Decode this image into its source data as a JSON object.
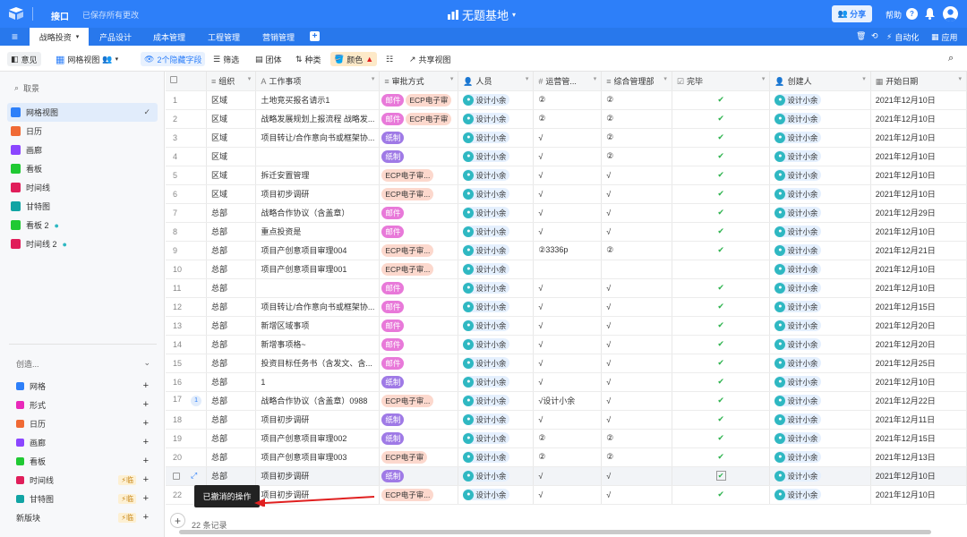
{
  "app": {
    "base_name": "接口",
    "saved_status": "已保存所有更改",
    "title": "无题基地",
    "share": "分享",
    "help": "帮助"
  },
  "tabs": [
    "战略投资",
    "产品设计",
    "成本管理",
    "工程管理",
    "营销管理"
  ],
  "tabbar_right": {
    "automation": "自动化",
    "apps": "应用"
  },
  "toolbar": {
    "views_label": "意见",
    "view_name": "网格视图",
    "hidden_fields": "2个隐藏字段",
    "filter": "筛选",
    "group": "团体",
    "sort": "种类",
    "color": "颜色",
    "share_view": "共享视图"
  },
  "sidebar": {
    "search": "取景",
    "views": [
      {
        "label": "网格视图",
        "icon": "grid-icon",
        "color": "#2d7ff9"
      },
      {
        "label": "日历",
        "icon": "calendar-icon",
        "color": "#f06a35"
      },
      {
        "label": "画廊",
        "icon": "gallery-icon",
        "color": "#8b46ff"
      },
      {
        "label": "看板",
        "icon": "kanban-icon",
        "color": "#20c933"
      },
      {
        "label": "时间线",
        "icon": "timeline-icon",
        "color": "#e01e5a"
      },
      {
        "label": "甘特图",
        "icon": "gantt-icon",
        "color": "#11a4a4"
      },
      {
        "label": "看板 2",
        "icon": "kanban-icon",
        "color": "#20c933"
      },
      {
        "label": "时间线 2",
        "icon": "timeline-icon",
        "color": "#e01e5a"
      }
    ],
    "create": "创造...",
    "create_items": [
      {
        "label": "网格",
        "color": "#2d7ff9",
        "badge": ""
      },
      {
        "label": "形式",
        "color": "#e929ba",
        "badge": ""
      },
      {
        "label": "日历",
        "color": "#f06a35",
        "badge": ""
      },
      {
        "label": "画廊",
        "color": "#8b46ff",
        "badge": ""
      },
      {
        "label": "看板",
        "color": "#20c933",
        "badge": ""
      },
      {
        "label": "时间线",
        "color": "#e01e5a",
        "badge": "临"
      },
      {
        "label": "甘特图",
        "color": "#11a4a4",
        "badge": "临"
      },
      {
        "label": "新版块",
        "color": "",
        "badge": "临"
      }
    ]
  },
  "grid": {
    "columns": [
      "组织",
      "工作事项",
      "审批方式",
      "人员",
      "运营管...",
      "综合管理部",
      "完毕",
      "创建人",
      "开始日期"
    ],
    "rows": [
      {
        "n": "1",
        "org": "区域",
        "item": "土地竞买报名请示1",
        "approval": [
          "邮件",
          "ECP电子审"
        ],
        "person": "设计小余",
        "ops": "②",
        "mgmt": "②",
        "done": true,
        "creator": "设计小余",
        "date": "2021年12月10日"
      },
      {
        "n": "2",
        "org": "区域",
        "item": "战略发展规划上报流程 战略发...",
        "approval": [
          "邮件",
          "ECP电子审"
        ],
        "person": "设计小余",
        "ops": "②",
        "mgmt": "②",
        "done": true,
        "creator": "设计小余",
        "date": "2021年12月10日"
      },
      {
        "n": "3",
        "org": "区域",
        "item": "项目转让/合作意向书或框架协...",
        "approval": [
          "纸制"
        ],
        "person": "设计小余",
        "ops": "√",
        "mgmt": "②",
        "done": true,
        "creator": "设计小余",
        "date": "2021年12月10日"
      },
      {
        "n": "4",
        "org": "区域",
        "item": "",
        "approval": [
          "纸制"
        ],
        "person": "设计小余",
        "ops": "√",
        "mgmt": "②",
        "done": true,
        "creator": "设计小余",
        "date": "2021年12月10日"
      },
      {
        "n": "5",
        "org": "区域",
        "item": "拆迁安置管理",
        "approval": [
          "ECP电子审..."
        ],
        "person": "设计小余",
        "ops": "√",
        "mgmt": "√",
        "done": true,
        "creator": "设计小余",
        "date": "2021年12月10日"
      },
      {
        "n": "6",
        "org": "区域",
        "item": "项目初步调研",
        "approval": [
          "ECP电子审..."
        ],
        "person": "设计小余",
        "ops": "√",
        "mgmt": "√",
        "done": true,
        "creator": "设计小余",
        "date": "2021年12月10日"
      },
      {
        "n": "7",
        "org": "总部",
        "item": "战略合作协议（含盖章）",
        "approval": [
          "邮件"
        ],
        "person": "设计小余",
        "ops": "√",
        "mgmt": "√",
        "done": true,
        "creator": "设计小余",
        "date": "2021年12月29日"
      },
      {
        "n": "8",
        "org": "总部",
        "item": "重点投资是",
        "approval": [
          "邮件"
        ],
        "person": "设计小余",
        "ops": "√",
        "mgmt": "√",
        "done": true,
        "creator": "设计小余",
        "date": "2021年12月10日"
      },
      {
        "n": "9",
        "org": "总部",
        "item": "项目产创意项目审理004",
        "approval": [
          "ECP电子审..."
        ],
        "person": "设计小余",
        "ops": "②3336p",
        "mgmt": "②",
        "done": true,
        "creator": "设计小余",
        "date": "2021年12月21日"
      },
      {
        "n": "10",
        "org": "总部",
        "item": "项目产创意项目审理001",
        "approval": [
          "ECP电子审..."
        ],
        "person": "设计小余",
        "ops": "",
        "mgmt": "",
        "done": false,
        "creator": "设计小余",
        "date": "2021年12月10日"
      },
      {
        "n": "11",
        "org": "总部",
        "item": "",
        "approval": [
          "邮件"
        ],
        "person": "设计小余",
        "ops": "√",
        "mgmt": "√",
        "done": true,
        "creator": "设计小余",
        "date": "2021年12月10日"
      },
      {
        "n": "12",
        "org": "总部",
        "item": "项目转让/合作意向书或框架协...",
        "approval": [
          "邮件"
        ],
        "person": "设计小余",
        "ops": "√",
        "mgmt": "√",
        "done": true,
        "creator": "设计小余",
        "date": "2021年12月15日"
      },
      {
        "n": "13",
        "org": "总部",
        "item": "新增区域事项",
        "approval": [
          "邮件"
        ],
        "person": "设计小余",
        "ops": "√",
        "mgmt": "√",
        "done": true,
        "creator": "设计小余",
        "date": "2021年12月20日"
      },
      {
        "n": "14",
        "org": "总部",
        "item": "新增事项格~",
        "approval": [
          "邮件"
        ],
        "person": "设计小余",
        "ops": "√",
        "mgmt": "√",
        "done": true,
        "creator": "设计小余",
        "date": "2021年12月20日"
      },
      {
        "n": "15",
        "org": "总部",
        "item": "投资目标任务书（含发文、含...",
        "approval": [
          "邮件"
        ],
        "person": "设计小余",
        "ops": "√",
        "mgmt": "√",
        "done": true,
        "creator": "设计小余",
        "date": "2021年12月25日"
      },
      {
        "n": "16",
        "org": "总部",
        "item": "1",
        "approval": [
          "纸制"
        ],
        "person": "设计小余",
        "ops": "√",
        "mgmt": "√",
        "done": true,
        "creator": "设计小余",
        "date": "2021年12月10日"
      },
      {
        "n": "17",
        "org": "总部",
        "item": "战略合作协议（含盖章）0988",
        "approval": [
          "ECP电子审..."
        ],
        "person": "设计小余",
        "ops": "√设计小余",
        "mgmt": "√",
        "done": true,
        "creator": "设计小余",
        "date": "2021年12月22日",
        "badge": "1"
      },
      {
        "n": "18",
        "org": "总部",
        "item": "项目初步调研",
        "approval": [
          "纸制"
        ],
        "person": "设计小余",
        "ops": "√",
        "mgmt": "√",
        "done": true,
        "creator": "设计小余",
        "date": "2021年12月11日"
      },
      {
        "n": "19",
        "org": "总部",
        "item": "项目产创意项目审理002",
        "approval": [
          "纸制"
        ],
        "person": "设计小余",
        "ops": "②",
        "mgmt": "②",
        "done": true,
        "creator": "设计小余",
        "date": "2021年12月15日"
      },
      {
        "n": "20",
        "org": "总部",
        "item": "项目产创意项目审理003",
        "approval": [
          "ECP电子审"
        ],
        "person": "设计小余",
        "ops": "②",
        "mgmt": "②",
        "done": true,
        "creator": "设计小余",
        "date": "2021年12月13日"
      },
      {
        "n": "",
        "org": "总部",
        "item": "项目初步调研",
        "approval": [
          "纸制"
        ],
        "person": "设计小余",
        "ops": "√",
        "mgmt": "√",
        "done": true,
        "boxed": true,
        "creator": "设计小余",
        "date": "2021年12月10日"
      },
      {
        "n": "22",
        "org": "",
        "item": "项目初步调研",
        "approval": [
          "ECP电子审..."
        ],
        "person": "设计小余",
        "ops": "√",
        "mgmt": "√",
        "done": true,
        "creator": "设计小余",
        "date": "2021年12月10日"
      }
    ],
    "record_count": "22 条记录"
  },
  "toast": "已撤消的操作",
  "colors": {
    "accent": "#2d7ff9",
    "check": "#2bb24c",
    "arrow": "#e02020"
  }
}
